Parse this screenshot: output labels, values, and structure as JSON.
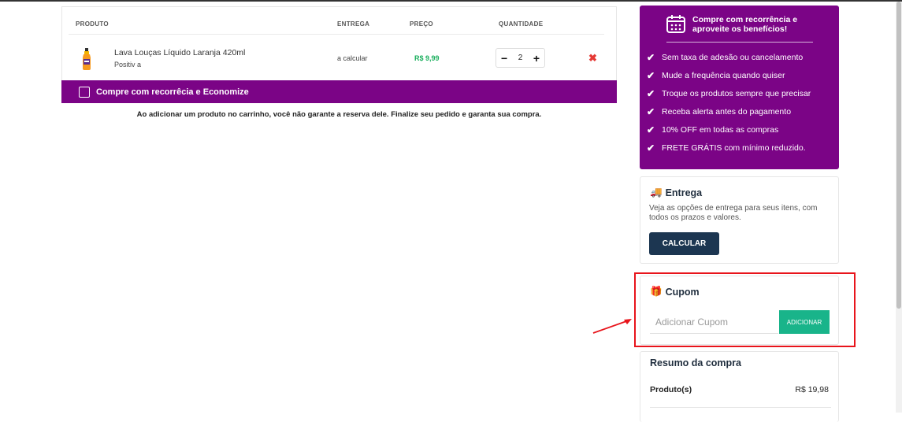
{
  "cart": {
    "headers": {
      "product": "PRODUTO",
      "delivery": "ENTREGA",
      "price": "PREÇO",
      "quantity": "QUANTIDADE"
    },
    "item": {
      "name": "Lava Louças Líquido Laranja 420ml",
      "brand": "Positiv a",
      "delivery": "a calcular",
      "price": "R$ 9,99",
      "quantity": "2",
      "minus": "−",
      "plus": "+",
      "remove": "✖"
    },
    "recurrence_label": "Compre com recorrêcia e Economize",
    "notice": "Ao adicionar um produto no carrinho, você não garante a reserva dele. Finalize seu pedido e garanta sua compra."
  },
  "benefits": {
    "title": "Compre com recorrência e aproveite os benefícios!",
    "items": [
      "Sem taxa de adesão ou cancelamento",
      "Mude a frequência quando quiser",
      "Troque os produtos sempre que precisar",
      "Receba alerta antes do pagamento",
      "10% OFF em todas as compras",
      "FRETE GRÁTIS com mínimo reduzido."
    ],
    "check": "✔"
  },
  "delivery": {
    "icon": "🚚",
    "title": "Entrega",
    "text": "Veja as opções de entrega para seus itens, com todos os prazos e valores.",
    "button": "CALCULAR"
  },
  "coupon": {
    "icon": "🎁",
    "title": "Cupom",
    "placeholder": "Adicionar Cupom",
    "button": "ADICIONAR"
  },
  "summary": {
    "title": "Resumo da compra",
    "products_label": "Produto(s)",
    "products_value": "R$ 19,98"
  },
  "colors": {
    "purple": "#7b0486",
    "green_price": "#1aaf5d",
    "navy_button": "#1c3651",
    "teal_button": "#19b48a",
    "highlight_red": "#e8141b"
  }
}
